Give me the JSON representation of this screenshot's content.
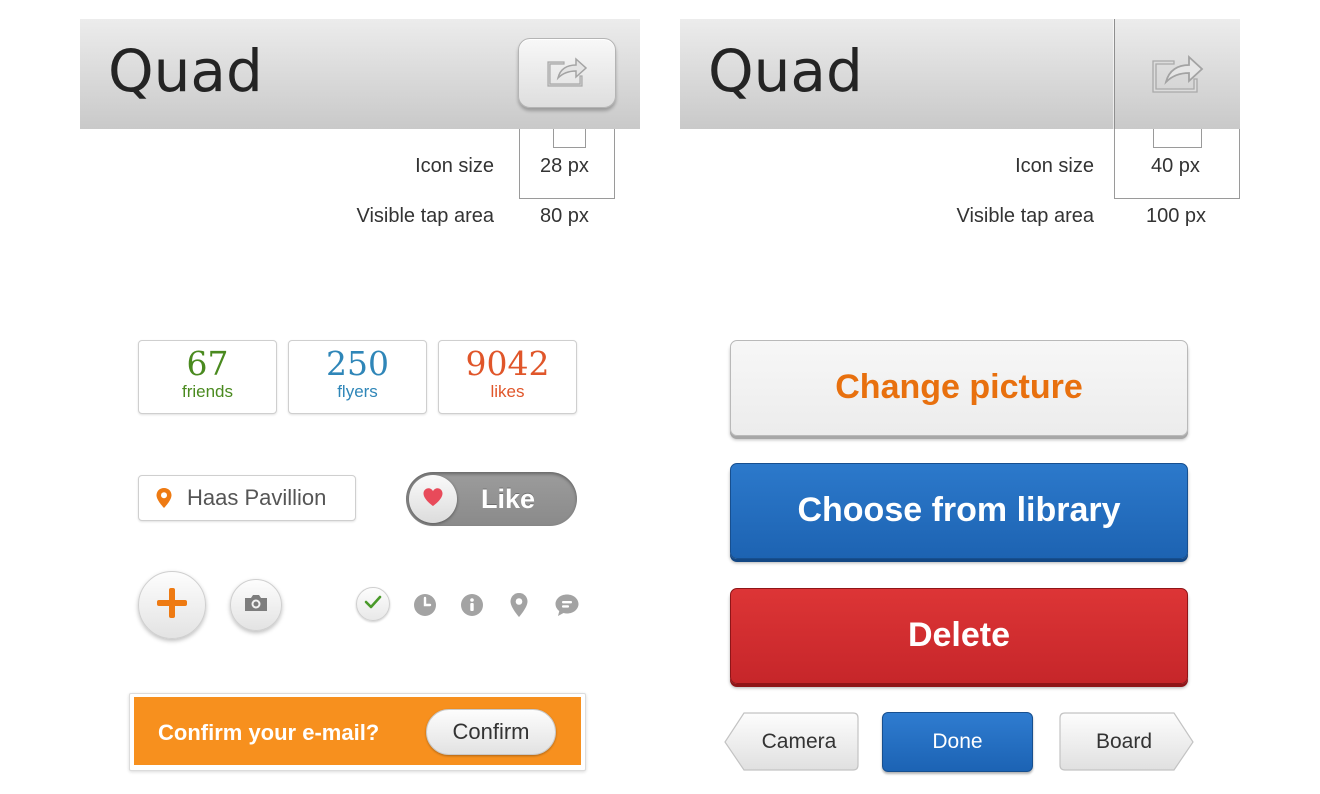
{
  "header_left": {
    "title": "Quad",
    "share_icon": "share-icon"
  },
  "header_right": {
    "title": "Quad",
    "share_icon": "share-icon"
  },
  "annotations_left": {
    "icon_size_label": "Icon size",
    "icon_size_value": "28 px",
    "tap_area_label": "Visible tap area",
    "tap_area_value": "80 px"
  },
  "annotations_right": {
    "icon_size_label": "Icon size",
    "icon_size_value": "40 px",
    "tap_area_label": "Visible tap area",
    "tap_area_value": "100 px"
  },
  "stats": [
    {
      "number": "67",
      "label": "friends",
      "color": "#4a8a1f"
    },
    {
      "number": "250",
      "label": "flyers",
      "color": "#2f86b8"
    },
    {
      "number": "9042",
      "label": "likes",
      "color": "#e0562a"
    }
  ],
  "location": {
    "icon": "map-pin-icon",
    "text": "Haas Pavillion",
    "color": "#ee7a12"
  },
  "like_toggle": {
    "label": "Like",
    "icon": "heart-icon"
  },
  "action_icons": [
    "plus-icon",
    "camera-icon",
    "check-icon",
    "clock-icon",
    "info-icon",
    "map-pin-icon",
    "chat-icon"
  ],
  "banner": {
    "message": "Confirm your e-mail?",
    "button": "Confirm",
    "color": "#f7901e"
  },
  "buttons": {
    "change_picture": "Change picture",
    "choose_library": "Choose from library",
    "delete": "Delete"
  },
  "toolbar": {
    "back": "Camera",
    "done": "Done",
    "forward": "Board"
  },
  "colors": {
    "orange": "#e8700e",
    "blue": "#1f66b6",
    "red": "#cf2c2f"
  }
}
